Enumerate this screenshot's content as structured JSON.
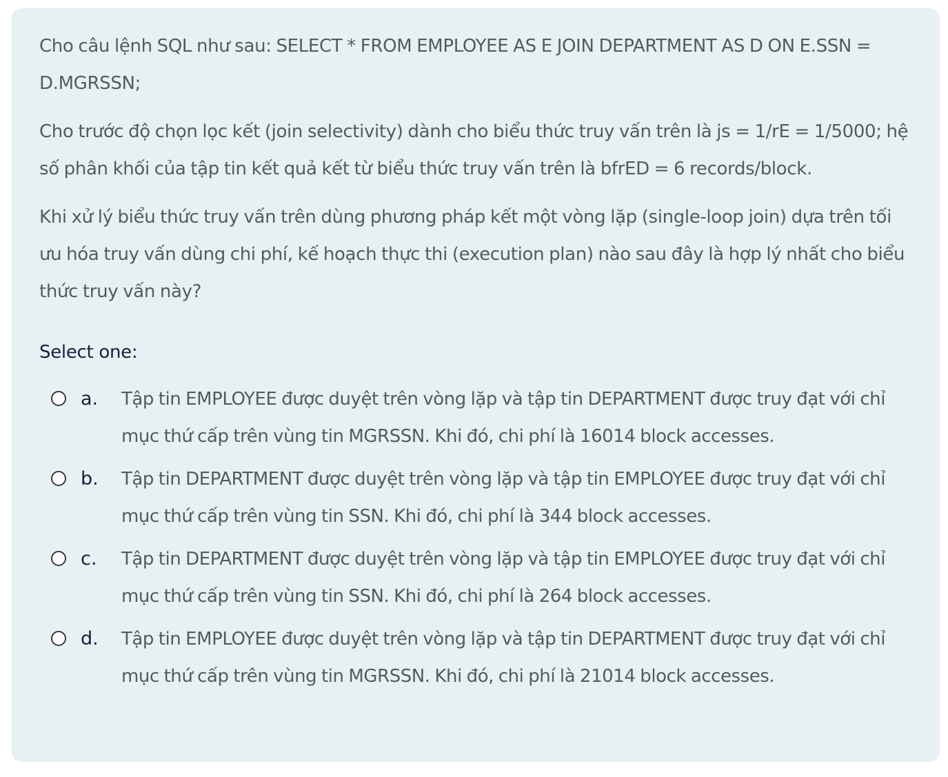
{
  "question": {
    "paragraphs": [
      "Cho câu lệnh SQL như sau: SELECT * FROM EMPLOYEE AS E JOIN DEPARTMENT AS D ON E.SSN = D.MGRSSN;",
      "Cho trước độ chọn lọc kết (join selectivity) dành cho biểu thức truy vấn trên là js = 1/rE = 1/5000; hệ số phân khối của tập tin kết quả kết từ biểu thức truy vấn trên là bfrED = 6 records/block.",
      "Khi xử lý biểu thức truy vấn trên dùng phương pháp kết một vòng lặp (single-loop join) dựa trên tối ưu hóa truy vấn dùng chi phí, kế hoạch thực thi (execution plan) nào sau đây là hợp lý nhất cho biểu thức truy vấn này?"
    ],
    "prompt": "Select one:",
    "options": [
      {
        "letter": "a.",
        "text": "Tập tin EMPLOYEE được duyệt trên vòng lặp và tập tin DEPARTMENT được truy đạt với chỉ mục thứ cấp trên vùng tin MGRSSN. Khi đó, chi phí là 16014 block accesses.",
        "selected": false
      },
      {
        "letter": "b.",
        "text": "Tập tin DEPARTMENT được duyệt trên vòng lặp và tập tin EMPLOYEE được truy đạt với chỉ mục thứ cấp trên vùng tin SSN. Khi đó, chi phí là 344 block accesses.",
        "selected": false
      },
      {
        "letter": "c.",
        "text": "Tập tin DEPARTMENT được duyệt trên vòng lặp và tập tin EMPLOYEE được truy đạt với chỉ mục thứ cấp trên vùng tin SSN. Khi đó, chi phí là 264 block accesses.",
        "selected": false
      },
      {
        "letter": "d.",
        "text": "Tập tin EMPLOYEE được duyệt trên vòng lặp và tập tin DEPARTMENT được truy đạt với chỉ mục thứ cấp trên vùng tin MGRSSN. Khi đó, chi phí là 21014 block accesses.",
        "selected": false
      }
    ]
  },
  "colors": {
    "card_background": "#e7f1f4",
    "body_text": "#555a60",
    "label_text": "#1f1c3b",
    "radio_border": "#3a3a3a"
  }
}
